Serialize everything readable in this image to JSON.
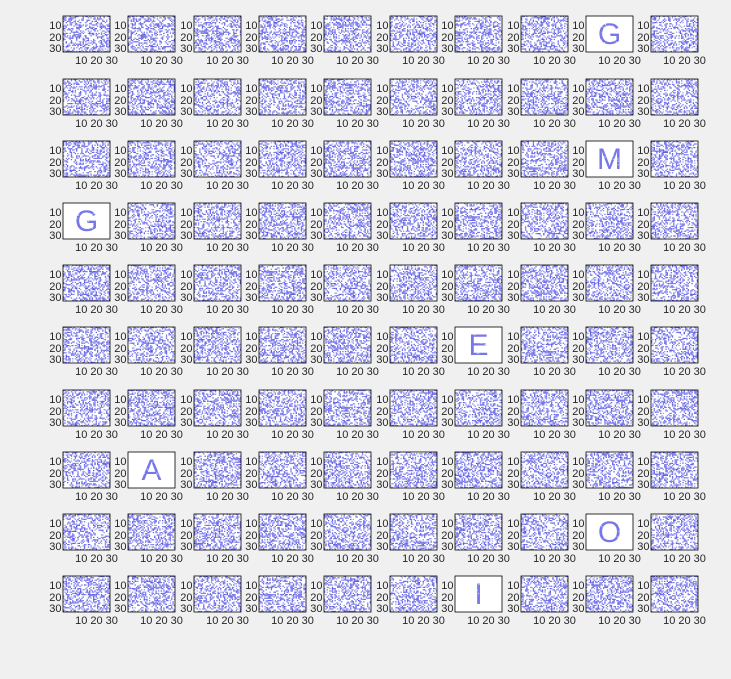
{
  "chart_data": {
    "type": "heatmap",
    "grid": {
      "rows": 10,
      "cols": 10
    },
    "axes": {
      "x_ticks": [
        10,
        20,
        30
      ],
      "y_ticks": [
        10,
        20,
        30
      ],
      "x_tick_label": "10 20 30",
      "xlim": [
        1,
        36
      ],
      "ylim": [
        1,
        30
      ]
    },
    "colors": {
      "background": "#f0f0f0",
      "pixel": "#4a4ae0",
      "panel": "#ffffff",
      "axis": "#000000"
    },
    "letter_panels": [
      {
        "row": 1,
        "col": 9,
        "letter": "G"
      },
      {
        "row": 3,
        "col": 9,
        "letter": "M"
      },
      {
        "row": 4,
        "col": 1,
        "letter": "G"
      },
      {
        "row": 6,
        "col": 7,
        "letter": "E"
      },
      {
        "row": 8,
        "col": 2,
        "letter": "A"
      },
      {
        "row": 9,
        "col": 9,
        "letter": "O"
      },
      {
        "row": 10,
        "col": 7,
        "letter": "I"
      }
    ]
  }
}
